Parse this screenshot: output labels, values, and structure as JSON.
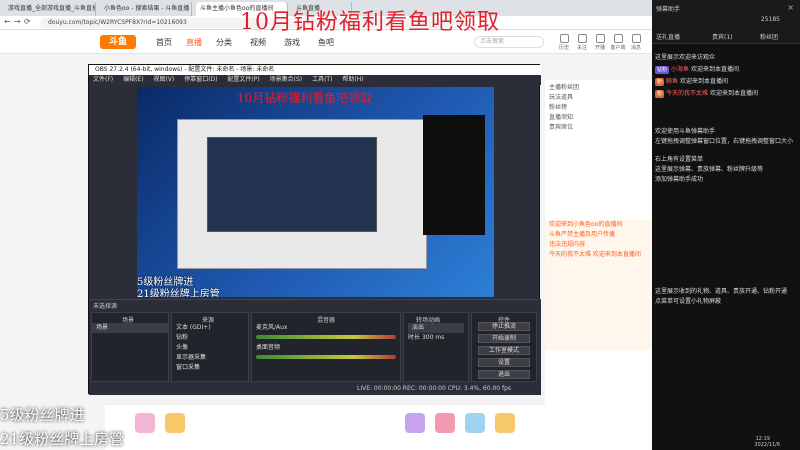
{
  "browser": {
    "tabs": [
      {
        "label": "游戏直播_全部游戏直播_斗鱼直播"
      },
      {
        "label": "小鱼色oo - 搜索结果 - 斗鱼直播"
      },
      {
        "label": "斗鱼主播小鱼色oo的直播间"
      },
      {
        "label": "斗鱼直播"
      }
    ],
    "url": "douyu.com/topic/W2RYCSPF8X?rid=10216093"
  },
  "site": {
    "logo": "斗鱼",
    "nav": [
      "首页",
      "直播",
      "分类",
      "视频",
      "游戏",
      "鱼吧"
    ],
    "search_placeholder": "点击搜索",
    "top_icons": [
      "历史",
      "关注",
      "开播",
      "客户端",
      "消息"
    ],
    "right_panel_rows": [
      "主播粉丝团",
      "玩法道具",
      "粉丝榜",
      "直播须知",
      "贵宾席位"
    ],
    "chat_strip": [
      "欢迎来到小鱼色oo的直播间",
      "斗鱼严禁主播及用户传播",
      "违法违规内容",
      "今天的我不太难 欢迎来到本直播间"
    ]
  },
  "overlay": {
    "title": "10月钻粉福利看鱼吧领取",
    "fan_line1": "5级粉丝牌进",
    "fan_line2": "21级粉丝牌上房管"
  },
  "obs": {
    "title": "OBS 27.2.4 (64-bit, windows) - 配置文件: 未命名 - 场景: 未命名",
    "menu": [
      "文件(F)",
      "编辑(E)",
      "视图(V)",
      "停靠窗口(D)",
      "配置文件(P)",
      "场景集合(S)",
      "工具(T)",
      "帮助(H)"
    ],
    "preview_title": "10月钻粉福利看鱼吧领取",
    "preview_fan": "5级粉丝牌进",
    "preview_fan2": "21级粉丝牌上房管",
    "no_source": "未选择源",
    "docks": {
      "scenes": {
        "title": "场景",
        "items": [
          "场景"
        ]
      },
      "sources": {
        "title": "来源",
        "items": [
          "文本 (GDI+)",
          "钻粉",
          "头像",
          "显示器采集",
          "窗口采集"
        ]
      },
      "mixer": {
        "title": "混音器",
        "items": [
          "麦克风/Aux",
          "桌面音频"
        ]
      },
      "transitions": {
        "title": "转场动画",
        "fade": "淡出",
        "duration_label": "时长",
        "duration": "300 ms"
      },
      "controls": {
        "title": "控件",
        "buttons": [
          "停止推流",
          "开始录制",
          "工作室模式",
          "设置",
          "退出"
        ]
      }
    },
    "status": "LIVE: 00:00:00   REC: 00:00:00   CPU: 3.4%, 60.00 fps"
  },
  "chat": {
    "title": "弹幕助手",
    "close": "×",
    "likes": "25185",
    "tabs": [
      "送礼直播",
      "贵宾(1)",
      "粉丝团"
    ],
    "lines": [
      {
        "badge": "",
        "user": "",
        "text": "这里展示欢迎来访观众"
      },
      {
        "badge": "钻粉",
        "user": "小海鱼",
        "text": "欢迎来到本直播间"
      },
      {
        "badge": "粉",
        "user": "鲸鱼",
        "text": "欢迎来到本直播间"
      },
      {
        "badge": "粉",
        "user": "今天的我不太难",
        "text": "欢迎来到本直播间"
      },
      {
        "badge": "",
        "user": "",
        "text": "欢迎使用斗鱼弹幕助手"
      },
      {
        "badge": "",
        "user": "",
        "text": "左键拖拽调整弹幕窗口位置，右键拖拽调整窗口大小"
      },
      {
        "badge": "",
        "user": "",
        "text": "右上角有设置菜单"
      },
      {
        "badge": "",
        "user": "",
        "text": "这里展示弹幕、贵族弹幕、粉丝牌升级等"
      },
      {
        "badge": "",
        "user": "",
        "text": "添加弹幕助手成功"
      },
      {
        "badge": "",
        "user": "",
        "text": "这里展示收到的礼物、道具、贵族开通、钻粉开通"
      },
      {
        "badge": "",
        "user": "",
        "text": "点菜单可设置小礼物屏蔽"
      }
    ]
  },
  "taskbar": {
    "time": "12:19",
    "date": "2022/11/6"
  },
  "colors": {
    "accent": "#ff5d23",
    "overlay_red": "#e0202a",
    "obs_bg": "#2b2e38"
  }
}
